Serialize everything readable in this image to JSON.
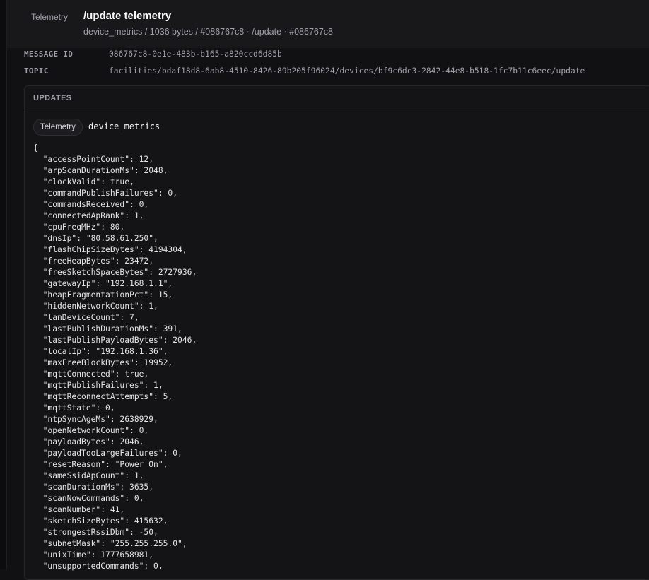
{
  "header": {
    "badge": "Telemetry",
    "title": "/update telemetry",
    "subtitle": "device_metrics / 1036 bytes / #086767c8 · /update · #086767c8"
  },
  "meta": {
    "message_id_label": "MESSAGE ID",
    "message_id": "086767c8-0e1e-483b-b165-a820ccd6d85b",
    "topic_label": "TOPIC",
    "topic": "facilities/bdaf18d8-6ab8-4510-8426-89b205f96024/devices/bf9c6dc3-2842-44e8-b518-1fc7b11c6eec/update"
  },
  "updates": {
    "heading": "UPDATES",
    "stream_badge": "Telemetry",
    "stream_name": "device_metrics",
    "json_lines": [
      "{",
      "  \"accessPointCount\": 12,",
      "  \"arpScanDurationMs\": 2048,",
      "  \"clockValid\": true,",
      "  \"commandPublishFailures\": 0,",
      "  \"commandsReceived\": 0,",
      "  \"connectedApRank\": 1,",
      "  \"cpuFreqMHz\": 80,",
      "  \"dnsIp\": \"80.58.61.250\",",
      "  \"flashChipSizeBytes\": 4194304,",
      "  \"freeHeapBytes\": 23472,",
      "  \"freeSketchSpaceBytes\": 2727936,",
      "  \"gatewayIp\": \"192.168.1.1\",",
      "  \"heapFragmentationPct\": 15,",
      "  \"hiddenNetworkCount\": 1,",
      "  \"lanDeviceCount\": 7,",
      "  \"lastPublishDurationMs\": 391,",
      "  \"lastPublishPayloadBytes\": 2046,",
      "  \"localIp\": \"192.168.1.36\",",
      "  \"maxFreeBlockBytes\": 19952,",
      "  \"mqttConnected\": true,",
      "  \"mqttPublishFailures\": 1,",
      "  \"mqttReconnectAttempts\": 5,",
      "  \"mqttState\": 0,",
      "  \"ntpSyncAgeMs\": 2638929,",
      "  \"openNetworkCount\": 0,",
      "  \"payloadBytes\": 2046,",
      "  \"payloadTooLargeFailures\": 0,",
      "  \"resetReason\": \"Power On\",",
      "  \"sameSsidApCount\": 1,",
      "  \"scanDurationMs\": 3635,",
      "  \"scanNowCommands\": 0,",
      "  \"scanNumber\": 41,",
      "  \"sketchSizeBytes\": 415632,",
      "  \"strongestRssiDbm\": -50,",
      "  \"subnetMask\": \"255.255.255.0\",",
      "  \"unixTime\": 1777658981,",
      "  \"unsupportedCommands\": 0,"
    ]
  }
}
